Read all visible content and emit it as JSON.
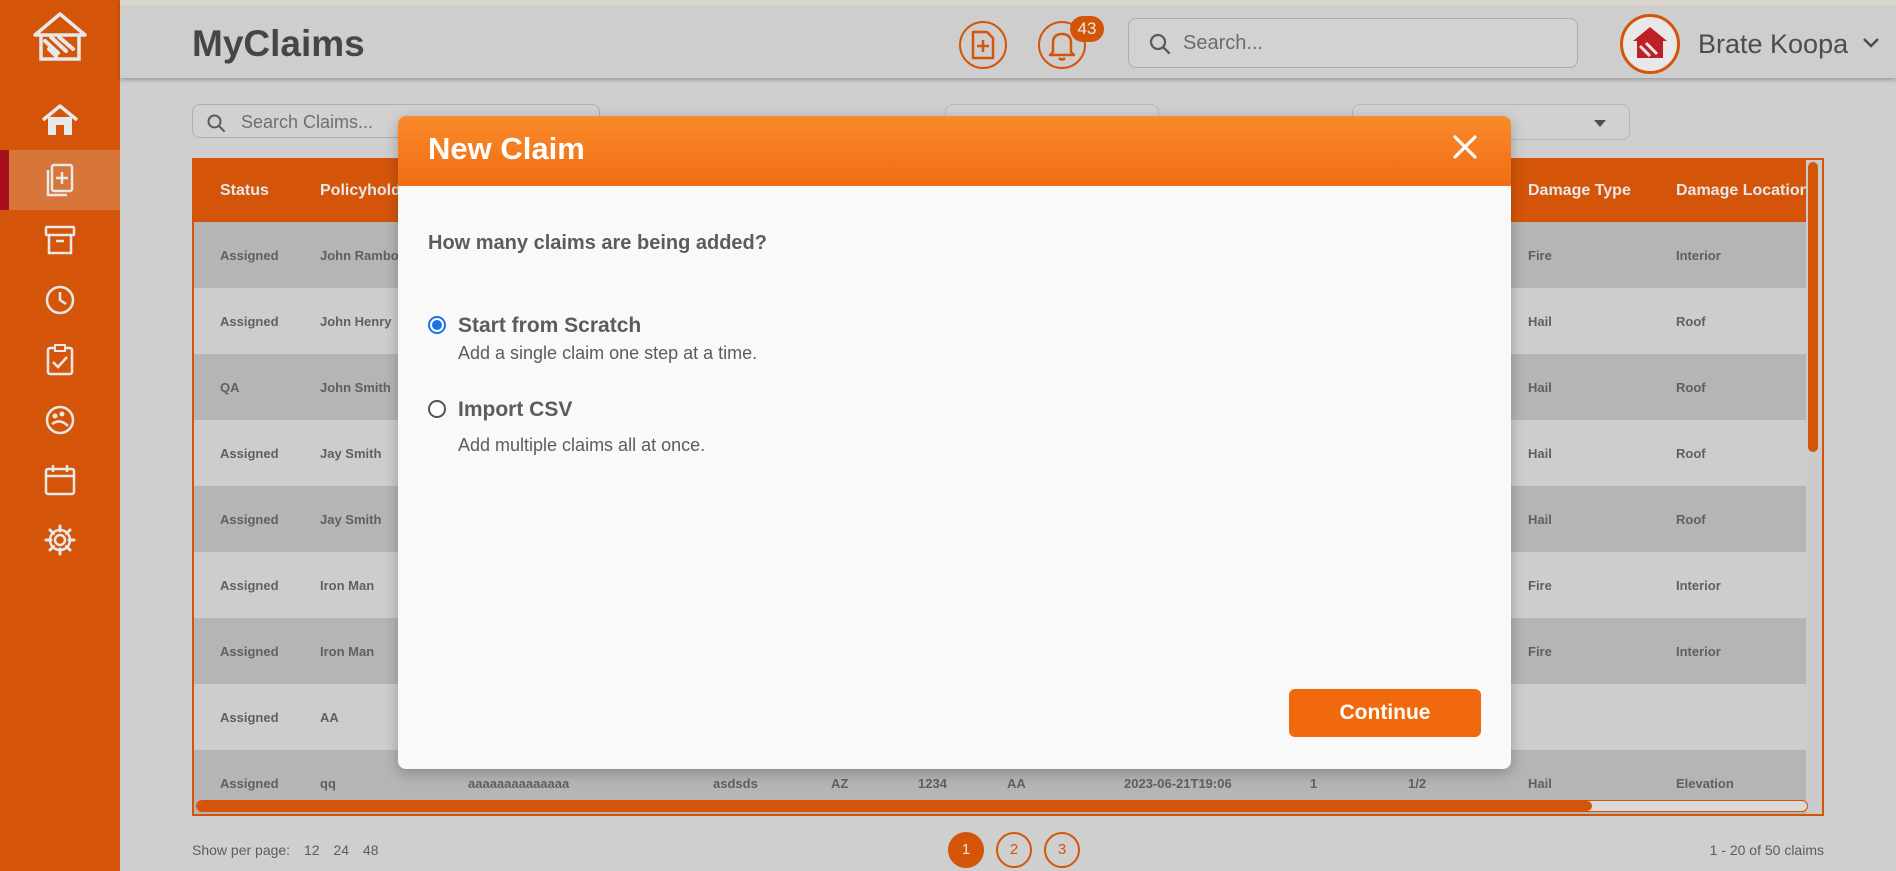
{
  "app": {
    "title": "MyClaims"
  },
  "colors": {
    "accent": "#ea5e0a",
    "active_marker": "#b8101e",
    "radio_selected": "#1a73e8"
  },
  "sidebar": {
    "items": [
      {
        "name": "home",
        "icon": "home-icon"
      },
      {
        "name": "claims",
        "icon": "document-add-icon",
        "active": true
      },
      {
        "name": "archive",
        "icon": "archive-box-icon"
      },
      {
        "name": "history",
        "icon": "clock-icon"
      },
      {
        "name": "tasks",
        "icon": "clipboard-check-icon"
      },
      {
        "name": "palette",
        "icon": "palette-icon"
      },
      {
        "name": "calendar",
        "icon": "calendar-icon"
      },
      {
        "name": "settings",
        "icon": "gear-icon"
      }
    ]
  },
  "header": {
    "notifications_count": "43",
    "search_placeholder": "Search...",
    "user_name": "Brate Koopa"
  },
  "filters": {
    "search_placeholder": "Search Claims..."
  },
  "table": {
    "headers_left": [
      "Status",
      "Policyhold"
    ],
    "headers_right": [
      "Damage Type",
      "Damage Location"
    ],
    "rows": [
      {
        "status": "Assigned",
        "policyholder": "John Rambo",
        "damage_type": "Fire",
        "damage_location": "Interior"
      },
      {
        "status": "Assigned",
        "policyholder": "John Henry",
        "damage_type": "Hail",
        "damage_location": "Roof"
      },
      {
        "status": "QA",
        "policyholder": "John Smith",
        "damage_type": "Hail",
        "damage_location": "Roof"
      },
      {
        "status": "Assigned",
        "policyholder": "Jay Smith",
        "damage_type": "Hail",
        "damage_location": "Roof"
      },
      {
        "status": "Assigned",
        "policyholder": "Jay Smith",
        "damage_type": "Hail",
        "damage_location": "Roof"
      },
      {
        "status": "Assigned",
        "policyholder": "Iron Man",
        "damage_type": "Fire",
        "damage_location": "Interior"
      },
      {
        "status": "Assigned",
        "policyholder": "Iron Man",
        "damage_type": "Fire",
        "damage_location": "Interior"
      },
      {
        "status": "Assigned",
        "policyholder": "AA",
        "damage_type": "",
        "damage_location": ""
      }
    ],
    "last_row": {
      "status": "Assigned",
      "policyholder": "qq",
      "col3": "aaaaaaaaaaaaaa",
      "col4": "asdsds",
      "col5": "AZ",
      "col6": "1234",
      "col7": "AA",
      "col8": "2023-06-21T19:06",
      "col9": "1",
      "col10": "1/2",
      "damage_type": "Hail",
      "damage_location": "Elevation"
    }
  },
  "footer": {
    "per_page_label": "Show per page:",
    "per_page_options": [
      "12",
      "24",
      "48"
    ],
    "pages": [
      "1",
      "2",
      "3"
    ],
    "count_text": "1 - 20 of 50 claims"
  },
  "modal": {
    "title": "New Claim",
    "question": "How many claims are being added?",
    "options": [
      {
        "label": "Start from Scratch",
        "description": "Add a single claim one step at a time.",
        "selected": true
      },
      {
        "label": "Import CSV",
        "description": "Add multiple claims all at once.",
        "selected": false
      }
    ],
    "continue_label": "Continue"
  }
}
